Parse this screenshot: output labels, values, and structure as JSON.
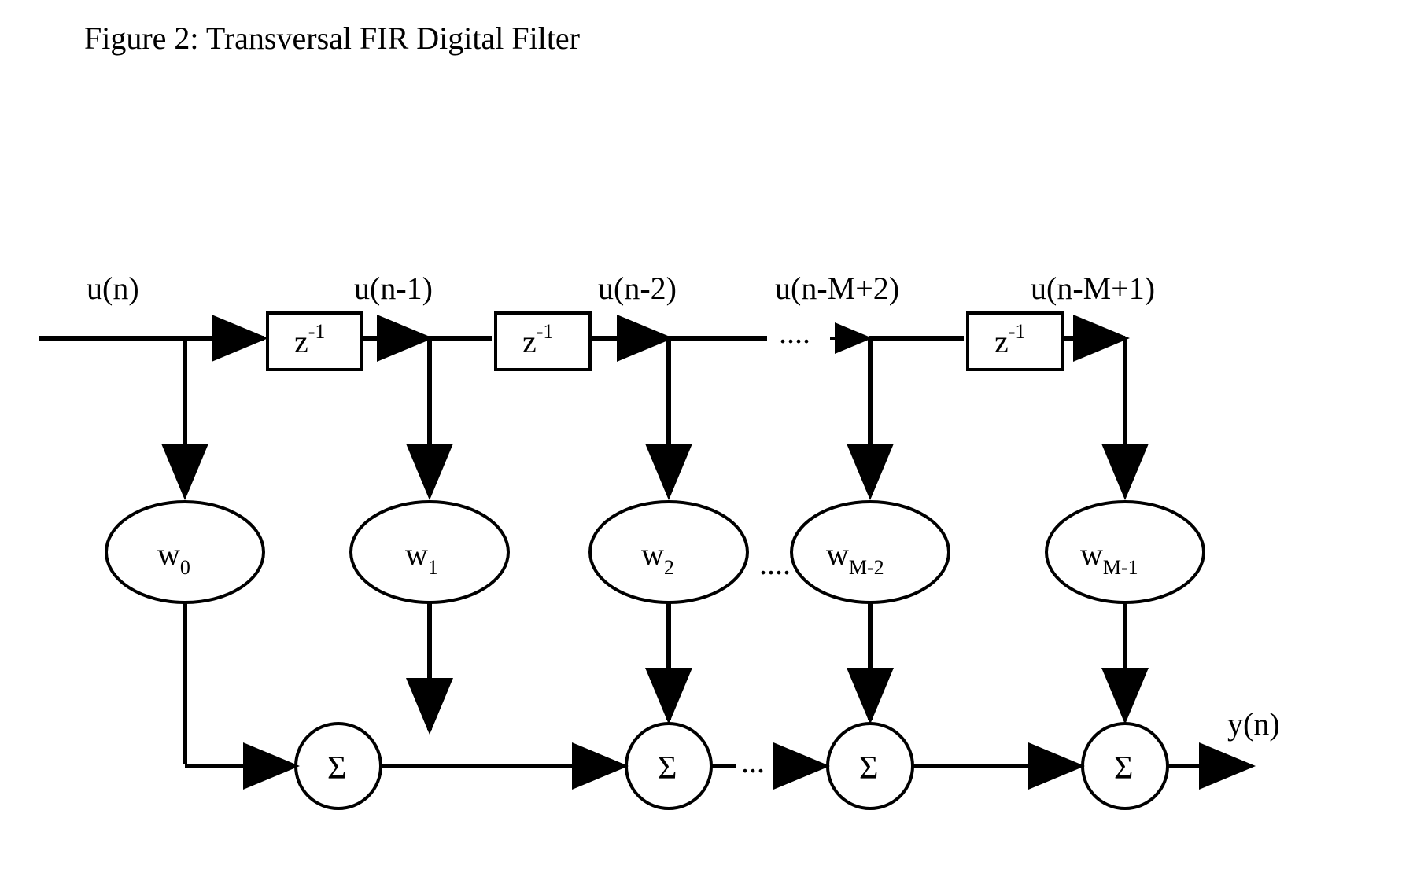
{
  "caption": "Figure 2: Transversal FIR Digital Filter",
  "diagram": {
    "input": "u(n)",
    "output": "y(n)",
    "delay_op": "z",
    "delay_exp": "-1",
    "sum_symbol": "Σ",
    "ellipsis_top": "....",
    "ellipsis_mid": "....",
    "ellipsis_bot": "...",
    "taps": [
      {
        "signal": "u(n)",
        "w_base": "w",
        "w_sub": "0"
      },
      {
        "signal": "u(n-1)",
        "w_base": "w",
        "w_sub": "1"
      },
      {
        "signal": "u(n-2)",
        "w_base": "w",
        "w_sub": "2"
      },
      {
        "signal": "u(n-M+2)",
        "w_base": "w",
        "w_sub": "M-2"
      },
      {
        "signal": "u(n-M+1)",
        "w_base": "w",
        "w_sub": "M-1"
      }
    ]
  }
}
